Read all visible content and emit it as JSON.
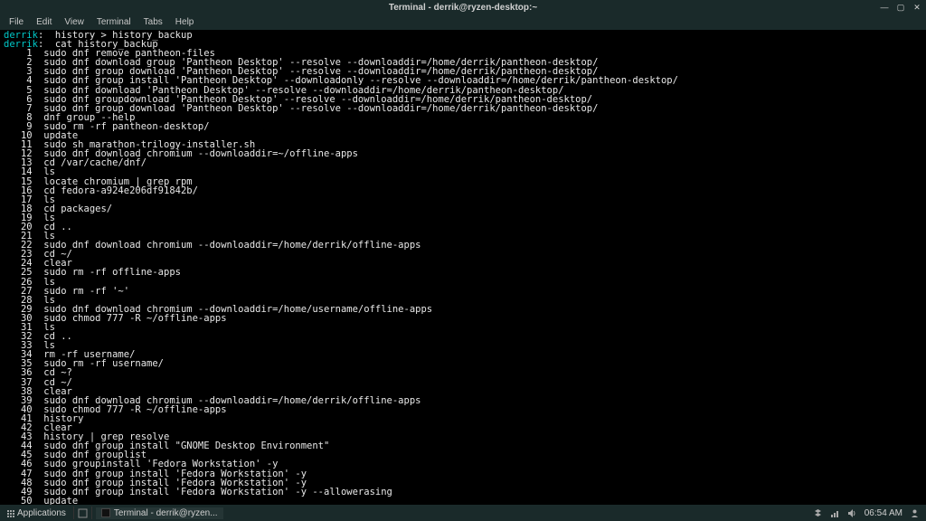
{
  "titlebar": {
    "title": "Terminal - derrik@ryzen-desktop:~",
    "min": "—",
    "max": "▢",
    "close": "✕"
  },
  "menubar": {
    "items": [
      "File",
      "Edit",
      "View",
      "Terminal",
      "Tabs",
      "Help"
    ]
  },
  "prompt": {
    "user": "derrik",
    "sep": ":",
    "lines": [
      {
        "cmd": "history > history_backup"
      },
      {
        "cmd": "cat history_backup"
      }
    ]
  },
  "history": [
    {
      "n": 1,
      "c": "sudo dnf remove pantheon-files"
    },
    {
      "n": 2,
      "c": "sudo dnf download group 'Pantheon Desktop' --resolve --downloaddir=/home/derrik/pantheon-desktop/"
    },
    {
      "n": 3,
      "c": "sudo dnf group download 'Pantheon Desktop' --resolve --downloaddir=/home/derrik/pantheon-desktop/"
    },
    {
      "n": 4,
      "c": "sudo dnf group install 'Pantheon Desktop' --downloadonly --resolve --downloaddir=/home/derrik/pantheon-desktop/"
    },
    {
      "n": 5,
      "c": "sudo dnf download 'Pantheon Desktop' --resolve --downloaddir=/home/derrik/pantheon-desktop/"
    },
    {
      "n": 6,
      "c": "sudo dnf groupdownload 'Pantheon Desktop' --resolve --downloaddir=/home/derrik/pantheon-desktop/"
    },
    {
      "n": 7,
      "c": "sudo dnf group download 'Pantheon Desktop' --resolve --downloaddir=/home/derrik/pantheon-desktop/"
    },
    {
      "n": 8,
      "c": "dnf group --help"
    },
    {
      "n": 9,
      "c": "sudo rm -rf pantheon-desktop/"
    },
    {
      "n": 10,
      "c": "update"
    },
    {
      "n": 11,
      "c": "sudo sh marathon-trilogy-installer.sh"
    },
    {
      "n": 12,
      "c": "sudo dnf download chromium --downloaddir=~/offline-apps"
    },
    {
      "n": 13,
      "c": "cd /var/cache/dnf/"
    },
    {
      "n": 14,
      "c": "ls"
    },
    {
      "n": 15,
      "c": "locate chromium | grep rpm"
    },
    {
      "n": 16,
      "c": "cd fedora-a924e206df91842b/"
    },
    {
      "n": 17,
      "c": "ls"
    },
    {
      "n": 18,
      "c": "cd packages/"
    },
    {
      "n": 19,
      "c": "ls"
    },
    {
      "n": 20,
      "c": "cd .."
    },
    {
      "n": 21,
      "c": "ls"
    },
    {
      "n": 22,
      "c": "sudo dnf download chromium --downloaddir=/home/derrik/offline-apps"
    },
    {
      "n": 23,
      "c": "cd ~/"
    },
    {
      "n": 24,
      "c": "clear"
    },
    {
      "n": 25,
      "c": "sudo rm -rf offline-apps"
    },
    {
      "n": 26,
      "c": "ls"
    },
    {
      "n": 27,
      "c": "sudo rm -rf '~'"
    },
    {
      "n": 28,
      "c": "ls"
    },
    {
      "n": 29,
      "c": "sudo dnf download chromium --downloaddir=/home/username/offline-apps"
    },
    {
      "n": 30,
      "c": "sudo chmod 777 -R ~/offline-apps"
    },
    {
      "n": 31,
      "c": "ls"
    },
    {
      "n": 32,
      "c": "cd .."
    },
    {
      "n": 33,
      "c": "ls"
    },
    {
      "n": 34,
      "c": "rm -rf username/"
    },
    {
      "n": 35,
      "c": "sudo rm -rf username/"
    },
    {
      "n": 36,
      "c": "cd ~?"
    },
    {
      "n": 37,
      "c": "cd ~/"
    },
    {
      "n": 38,
      "c": "clear"
    },
    {
      "n": 39,
      "c": "sudo dnf download chromium --downloaddir=/home/derrik/offline-apps"
    },
    {
      "n": 40,
      "c": "sudo chmod 777 -R ~/offline-apps"
    },
    {
      "n": 41,
      "c": "history"
    },
    {
      "n": 42,
      "c": "clear"
    },
    {
      "n": 43,
      "c": "history | grep resolve"
    },
    {
      "n": 44,
      "c": "sudo dnf group install \"GNOME Desktop Environment\""
    },
    {
      "n": 45,
      "c": "sudo dnf grouplist"
    },
    {
      "n": 46,
      "c": "sudo groupinstall 'Fedora Workstation' -y"
    },
    {
      "n": 47,
      "c": "sudo dnf group install 'Fedora Workstation' -y"
    },
    {
      "n": 48,
      "c": "sudo dnf group install 'Fedora Workstation' -y"
    },
    {
      "n": 49,
      "c": "sudo dnf group install 'Fedora Workstation' -y --allowerasing"
    },
    {
      "n": 50,
      "c": "update"
    }
  ],
  "taskbar": {
    "apps_label": "Applications",
    "task_label": "Terminal - derrik@ryzen...",
    "clock": "06:54 AM"
  }
}
